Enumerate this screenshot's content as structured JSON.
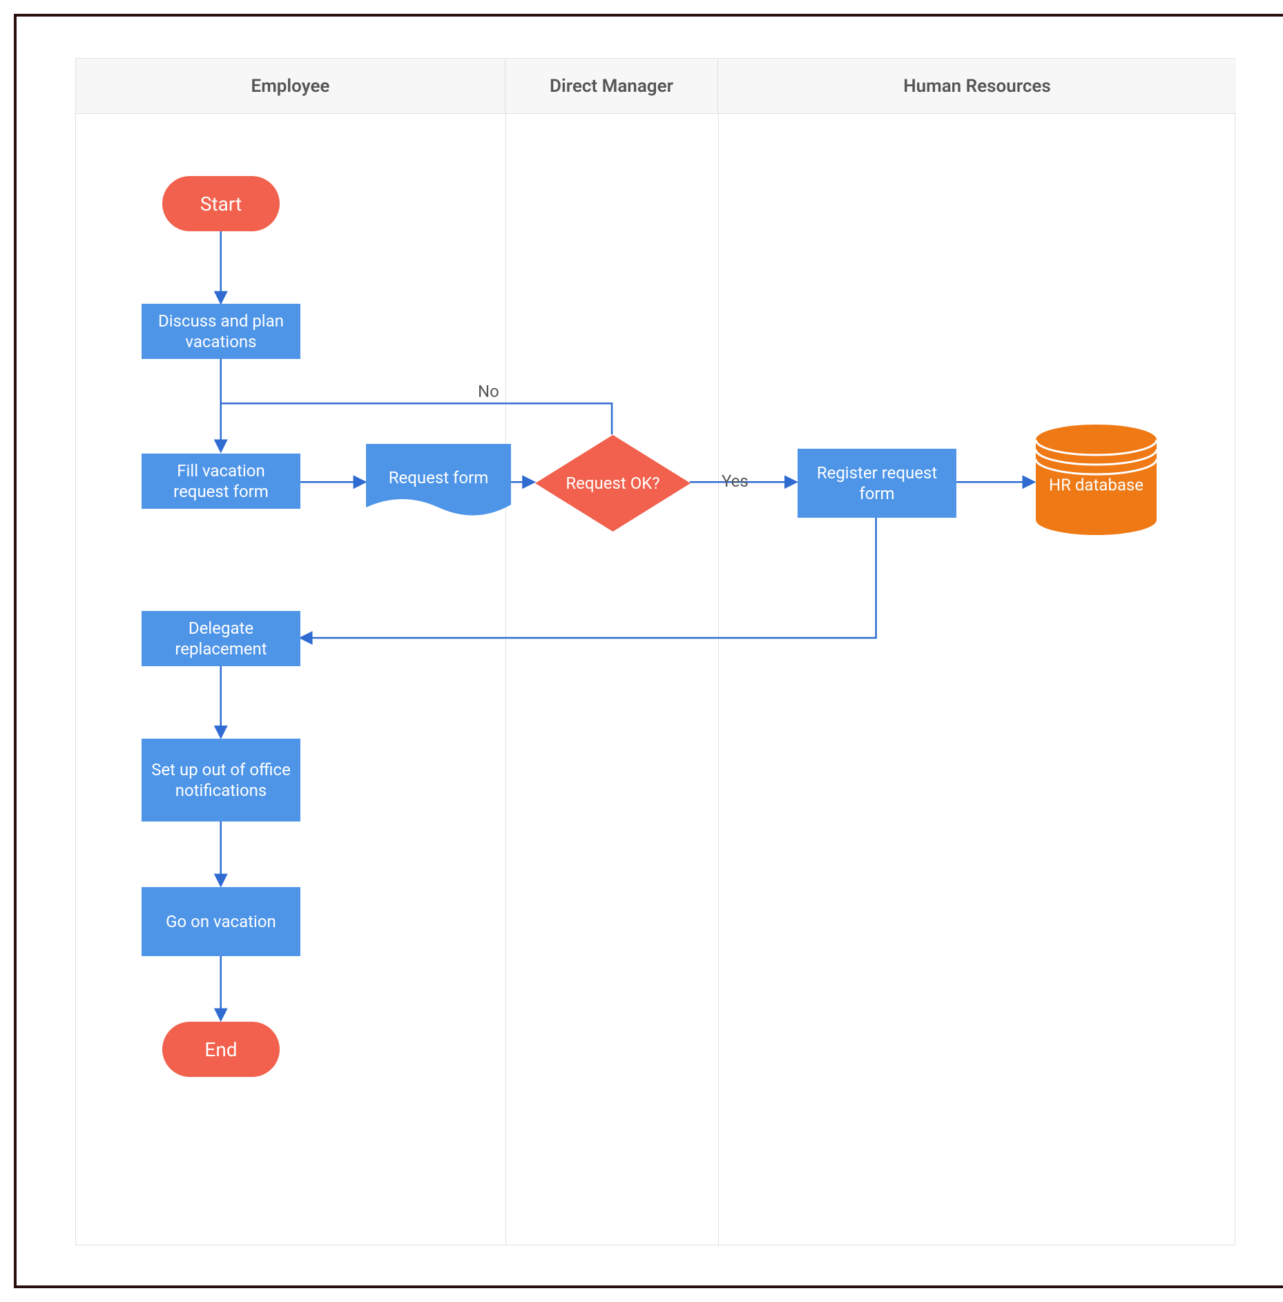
{
  "lanes": {
    "employee": "Employee",
    "direct_manager": "Direct Manager",
    "human_resources": "Human Resources"
  },
  "nodes": {
    "start": "Start",
    "discuss": "Discuss and plan vacations",
    "fill_form": "Fill vacation request form",
    "request_form_doc": "Request form",
    "request_ok": "Request OK?",
    "register": "Register request form",
    "hr_db": "HR database",
    "delegate": "Delegate replacement",
    "ooo": "Set up out of office notifications",
    "go_vacation": "Go on vacation",
    "end": "End"
  },
  "edges": {
    "no": "No",
    "yes": "Yes"
  },
  "chart_data": {
    "type": "swimlane-flowchart",
    "lanes": [
      "Employee",
      "Direct Manager",
      "Human Resources"
    ],
    "nodes": [
      {
        "id": "start",
        "type": "terminator",
        "lane": "Employee",
        "label": "Start"
      },
      {
        "id": "discuss",
        "type": "process",
        "lane": "Employee",
        "label": "Discuss and plan vacations"
      },
      {
        "id": "fill_form",
        "type": "process",
        "lane": "Employee",
        "label": "Fill vacation request form"
      },
      {
        "id": "request_form",
        "type": "document",
        "lane": "Employee",
        "label": "Request form"
      },
      {
        "id": "request_ok",
        "type": "decision",
        "lane": "Direct Manager",
        "label": "Request OK?"
      },
      {
        "id": "register",
        "type": "process",
        "lane": "Human Resources",
        "label": "Register request form"
      },
      {
        "id": "hr_db",
        "type": "datastore",
        "lane": "Human Resources",
        "label": "HR database"
      },
      {
        "id": "delegate",
        "type": "process",
        "lane": "Employee",
        "label": "Delegate replacement"
      },
      {
        "id": "ooo",
        "type": "process",
        "lane": "Employee",
        "label": "Set up out of office notifications"
      },
      {
        "id": "go_vacation",
        "type": "process",
        "lane": "Employee",
        "label": "Go on vacation"
      },
      {
        "id": "end",
        "type": "terminator",
        "lane": "Employee",
        "label": "End"
      }
    ],
    "edges": [
      {
        "from": "start",
        "to": "discuss"
      },
      {
        "from": "discuss",
        "to": "fill_form"
      },
      {
        "from": "fill_form",
        "to": "request_form"
      },
      {
        "from": "request_form",
        "to": "request_ok"
      },
      {
        "from": "request_ok",
        "to": "fill_form",
        "label": "No"
      },
      {
        "from": "request_ok",
        "to": "register",
        "label": "Yes"
      },
      {
        "from": "register",
        "to": "hr_db"
      },
      {
        "from": "register",
        "to": "delegate"
      },
      {
        "from": "delegate",
        "to": "ooo"
      },
      {
        "from": "ooo",
        "to": "go_vacation"
      },
      {
        "from": "go_vacation",
        "to": "end"
      }
    ]
  }
}
